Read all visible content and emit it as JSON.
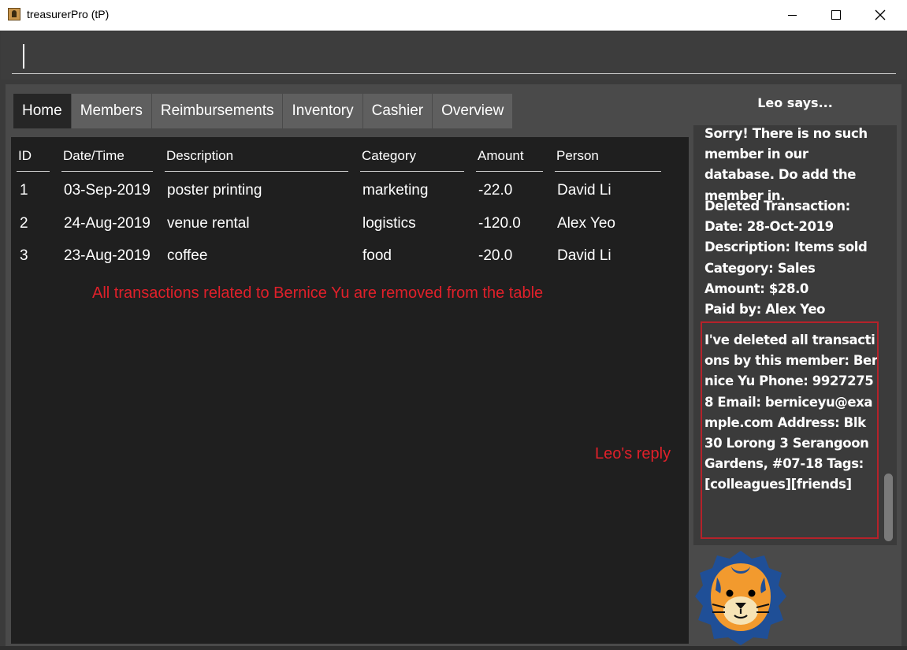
{
  "window": {
    "title": "treasurerPro (tP)"
  },
  "command": {
    "value": ""
  },
  "tabs": [
    {
      "label": "Home"
    },
    {
      "label": "Members"
    },
    {
      "label": "Reimbursements"
    },
    {
      "label": "Inventory"
    },
    {
      "label": "Cashier"
    },
    {
      "label": "Overview"
    }
  ],
  "table": {
    "columns": [
      "ID",
      "Date/Time",
      "Description",
      "Category",
      "Amount",
      "Person"
    ],
    "rows": [
      [
        "1",
        "03-Sep-2019",
        "poster printing",
        "marketing",
        "-22.0",
        "David Li"
      ],
      [
        "2",
        "24-Aug-2019",
        "venue rental",
        "logistics",
        "-120.0",
        "Alex Yeo"
      ],
      [
        "3",
        "23-Aug-2019",
        "coffee",
        "food",
        "-20.0",
        "David Li"
      ]
    ]
  },
  "annotations": {
    "table_note": "All transactions related to Bernice Yu are removed from the table",
    "reply_note": "Leo's reply"
  },
  "leo": {
    "title": "Leo says...",
    "messages": [
      "Sorry! There is no such member in our database. Do add the member in.",
      "Deleted Transaction:\nDate: 28-Oct-2019\nDescription: Items sold\nCategory: Sales\nAmount: $28.0\nPaid by: Alex Yeo",
      "I've deleted all transactions by this member:\nBernice Yu Phone: 99272758 Email: berniceyu@example.com Address: Blk 30 Lorong 3 Serangoon Gardens, #07-18 Tags: [colleagues][friends]"
    ]
  },
  "colors": {
    "annotation": "#e0202a",
    "lion_mane": "#1f4f97",
    "lion_face": "#f29a2e"
  },
  "icons": {
    "app": "app-icon",
    "minimize": "minimize-icon",
    "maximize": "maximize-icon",
    "close": "close-icon",
    "mascot": "lion-mascot-icon"
  }
}
